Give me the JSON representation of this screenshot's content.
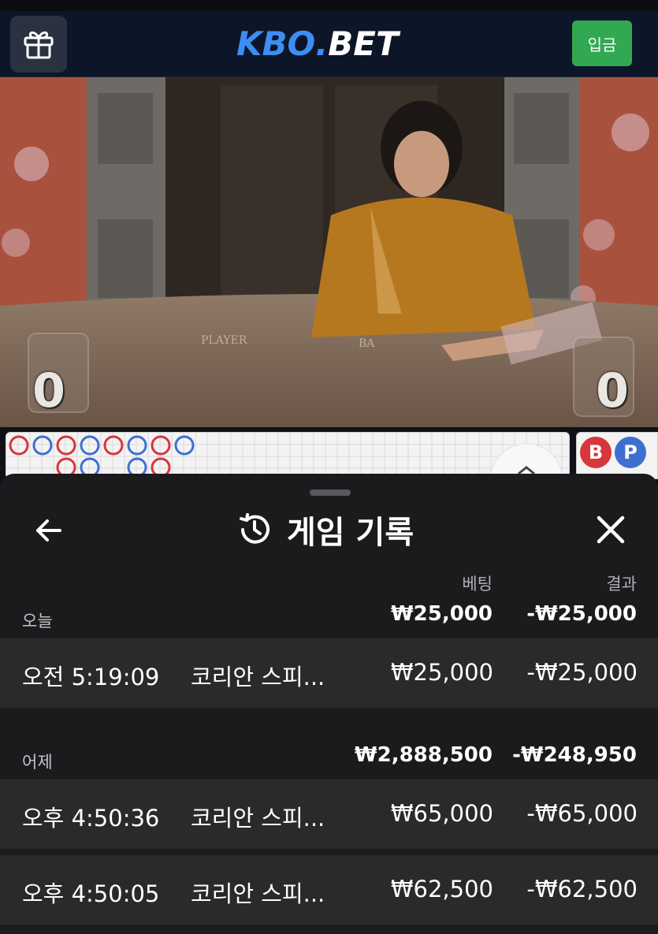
{
  "header": {
    "logo_part1": "KBO",
    "logo_dot": ".",
    "logo_part2": "BET",
    "deposit_label": "입금"
  },
  "video": {
    "table_label_player": "PLAYER",
    "table_label_banker": "BA",
    "player_score": "0",
    "banker_score": "0"
  },
  "roadmap": {
    "banker_badge": "B",
    "player_badge": "P"
  },
  "history": {
    "title": "게임 기록",
    "column_bet": "베팅",
    "column_result": "결과",
    "groups": [
      {
        "label": "오늘",
        "total_bet": "₩25,000",
        "total_result": "-₩25,000",
        "records": [
          {
            "time": "오전 5:19:09",
            "game": "코리안 스피...",
            "bet": "₩25,000",
            "result": "-₩25,000"
          }
        ]
      },
      {
        "label": "어제",
        "total_bet": "₩2,888,500",
        "total_result": "-₩248,950",
        "records": [
          {
            "time": "오후 4:50:36",
            "game": "코리안 스피...",
            "bet": "₩65,000",
            "result": "-₩65,000"
          },
          {
            "time": "오후 4:50:05",
            "game": "코리안 스피...",
            "bet": "₩62,500",
            "result": "-₩62,500"
          }
        ]
      }
    ]
  },
  "colors": {
    "brand_blue": "#3e8df5",
    "deposit_green": "#32a852",
    "banker_red": "#d6363c",
    "player_blue": "#3e6fd0",
    "sheet_bg": "#1b1b1d"
  }
}
